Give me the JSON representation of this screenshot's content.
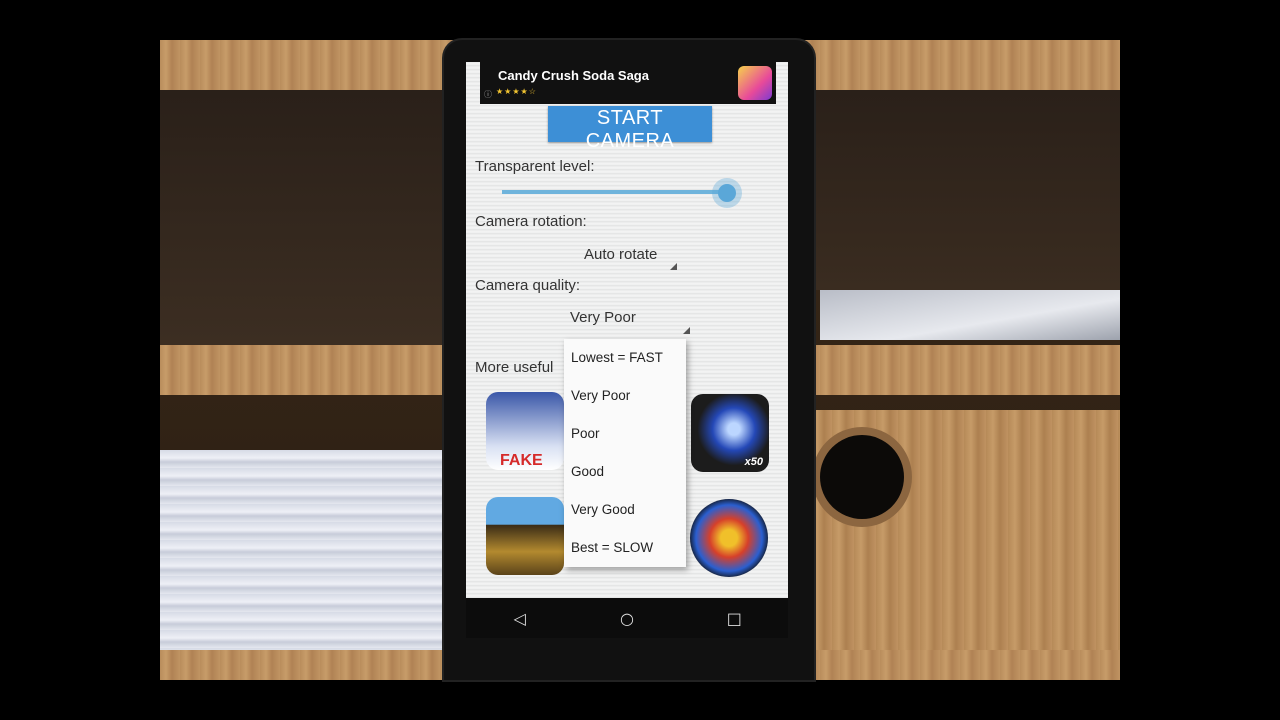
{
  "ad": {
    "title": "Candy Crush Soda Saga",
    "stars": "★★★★☆",
    "info": "ⓘ"
  },
  "main": {
    "start_button": "START CAMERA",
    "transparent_label": "Transparent level:",
    "transparent_value": 0.95,
    "rotation_label": "Camera rotation:",
    "rotation_value": "Auto rotate",
    "quality_label": "Camera quality:",
    "quality_value": "Very Poor",
    "more_label": "More useful",
    "fake_tile_text": "FAKE",
    "flash_tile_text": "x50"
  },
  "quality_options": [
    "Lowest = FAST",
    "Very Poor",
    "Poor",
    "Good",
    "Very Good",
    "Best = SLOW"
  ],
  "nav": {
    "back": "◁",
    "home": "○",
    "recents": "□"
  },
  "colors": {
    "accent": "#3d8fd6",
    "slider": "#6fb4dc"
  }
}
